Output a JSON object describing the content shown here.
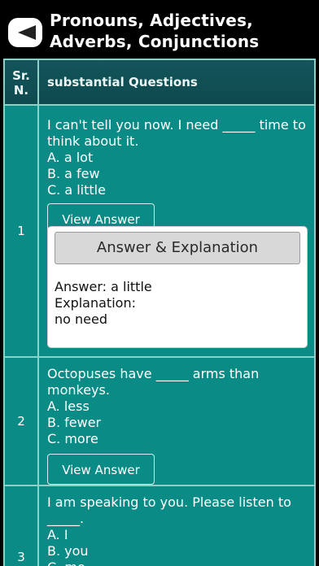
{
  "header": {
    "title": "Pronouns, Adjectives, Adverbs, Conjunctions",
    "back_icon": "back-arrow-icon"
  },
  "table": {
    "col_sr": "Sr. N.",
    "col_questions": "substantial Questions"
  },
  "rows": [
    {
      "number": "1",
      "question": "I can't tell you now. I need _____ time to think about it.",
      "options": [
        "A. a lot",
        "B. a few",
        "C. a little"
      ],
      "view_answer": "View Answer",
      "answer_title": "Answer & Explanation",
      "answer": "Answer: a little",
      "explanation_label": "Explanation:",
      "explanation": "no need"
    },
    {
      "number": "2",
      "question": "Octopuses have _____ arms than monkeys.",
      "options": [
        "A. less",
        "B. fewer",
        "C. more"
      ],
      "view_answer": "View Answer"
    },
    {
      "number": "3",
      "question": "I am speaking to you. Please listen to _____.",
      "options": [
        "A. I",
        "B. you",
        "C. me"
      ]
    }
  ]
}
